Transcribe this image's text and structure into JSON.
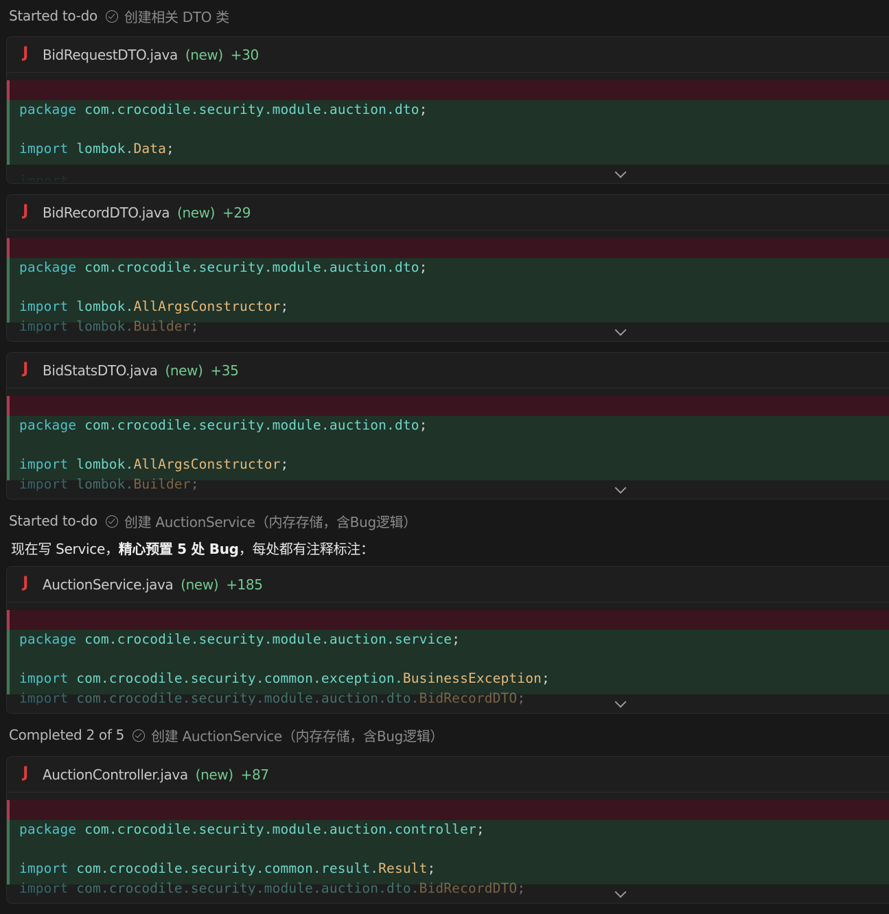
{
  "steps": [
    {
      "lead": "Started to-do",
      "task": "创建相关 DTO 类"
    },
    {
      "lead": "Started to-do",
      "task": "创建 AuctionService（内存存储，含Bug逻辑）"
    },
    {
      "lead": "Completed 2 of 5",
      "task": "创建 AuctionService（内存存储，含Bug逻辑）"
    }
  ],
  "message": {
    "part1": "现在写 Service，",
    "bold": "精心预置 5 处 Bug",
    "part2": "，每处都有注释标注："
  },
  "files": [
    {
      "name": "BidRequestDTO.java",
      "status": "(new)",
      "added": "+30",
      "line1": {
        "kw": "package",
        "pkg": "com.crocodile.security.module.auction.dto",
        "end": ";"
      },
      "line2": {
        "kw": "import",
        "pkg": "lombok.",
        "cls": "Data",
        "end": ";"
      },
      "line3": {
        "kw": "import",
        "pkg": "",
        "cls": "",
        "end": ""
      }
    },
    {
      "name": "BidRecordDTO.java",
      "status": "(new)",
      "added": "+29",
      "line1": {
        "kw": "package",
        "pkg": "com.crocodile.security.module.auction.dto",
        "end": ";"
      },
      "line2": {
        "kw": "import",
        "pkg": "lombok.",
        "cls": "AllArgsConstructor",
        "end": ";"
      },
      "line3": {
        "kw": "import",
        "pkg": "lombok.",
        "cls": "Builder",
        "end": ";"
      }
    },
    {
      "name": "BidStatsDTO.java",
      "status": "(new)",
      "added": "+35",
      "line1": {
        "kw": "package",
        "pkg": "com.crocodile.security.module.auction.dto",
        "end": ";"
      },
      "line2": {
        "kw": "import",
        "pkg": "lombok.",
        "cls": "AllArgsConstructor",
        "end": ";"
      },
      "line3": {
        "kw": "import",
        "pkg": "lombok.",
        "cls": "Builder",
        "end": ";"
      }
    },
    {
      "name": "AuctionService.java",
      "status": "(new)",
      "added": "+185",
      "line1": {
        "kw": "package",
        "pkg": "com.crocodile.security.module.auction.service",
        "end": ";"
      },
      "line2": {
        "kw": "import",
        "pkg": "com.crocodile.security.common.exception.",
        "cls": "BusinessException",
        "end": ";"
      },
      "line3": {
        "kw": "import",
        "pkg": "com.crocodile.security.module.auction.dto.",
        "cls": "BidRecordDTO",
        "end": ";"
      }
    },
    {
      "name": "AuctionController.java",
      "status": "(new)",
      "added": "+87",
      "line1": {
        "kw": "package",
        "pkg": "com.crocodile.security.module.auction.controller",
        "end": ";"
      },
      "line2": {
        "kw": "import",
        "pkg": "com.crocodile.security.common.result.",
        "cls": "Result",
        "end": ";"
      },
      "line3": {
        "kw": "import",
        "pkg": "com.crocodile.security.module.auction.dto.",
        "cls": "BidRecordDTO",
        "end": ";"
      }
    }
  ],
  "icons": {
    "file_type": "java-j-icon",
    "step": "check-circle-icon",
    "expand": "chevron-down-icon"
  },
  "colors": {
    "added": "#73c991",
    "deleted_bg": "#3a1520",
    "added_bg": "#1f3328",
    "java_icon": "#e03c3c"
  }
}
